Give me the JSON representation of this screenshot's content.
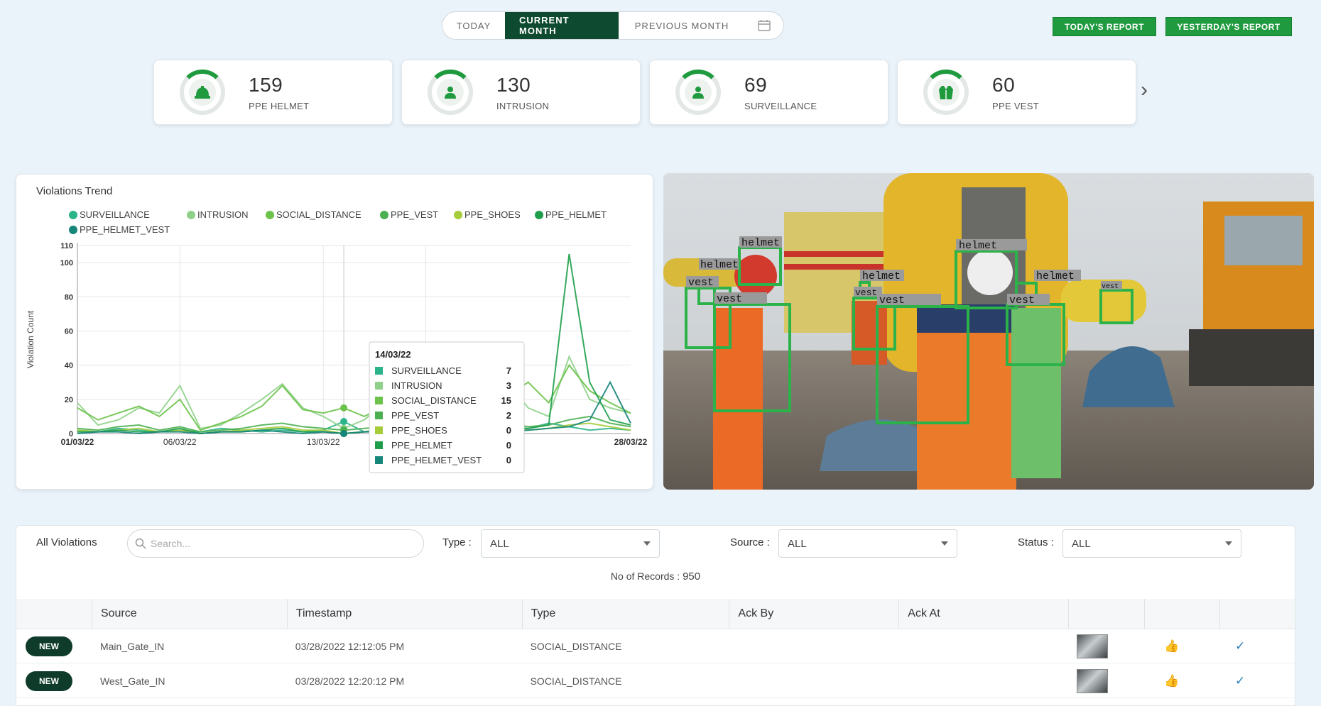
{
  "header": {
    "periods": [
      "TODAY",
      "CURRENT MONTH",
      "PREVIOUS MONTH"
    ],
    "active_period": "CURRENT MONTH",
    "calendar_icon": "calendar-icon",
    "today_report_label": "TODAY'S REPORT",
    "yesterday_report_label": "YESTERDAY'S REPORT"
  },
  "cards": [
    {
      "value": "159",
      "label": "PPE HELMET",
      "icon": "helmet-icon"
    },
    {
      "value": "130",
      "label": "INTRUSION",
      "icon": "person-alert-icon"
    },
    {
      "value": "69",
      "label": "SURVEILLANCE",
      "icon": "person-alert-icon"
    },
    {
      "value": "60",
      "label": "PPE VEST",
      "icon": "vest-icon"
    }
  ],
  "colors": {
    "accent": "#1f9a3f",
    "dark_green": "#0e4a2f",
    "badge": "#0e3b2a",
    "page_bg": "#eaf3fa",
    "detection_box": "#2bb34a"
  },
  "chart_data": {
    "type": "line",
    "title": "Violations Trend",
    "ylabel": "Violation Count",
    "xlabel": "",
    "ylim": [
      0,
      110
    ],
    "y_ticks": [
      0,
      20,
      40,
      60,
      80,
      100,
      110
    ],
    "x_tick_labels": [
      "01/03/22",
      "06/03/22",
      "13/03/22",
      "28/03/22"
    ],
    "legend_position": "top-left",
    "x": [
      "01/03/22",
      "02/03/22",
      "03/03/22",
      "04/03/22",
      "05/03/22",
      "06/03/22",
      "07/03/22",
      "08/03/22",
      "09/03/22",
      "10/03/22",
      "11/03/22",
      "12/03/22",
      "13/03/22",
      "14/03/22",
      "15/03/22",
      "16/03/22",
      "17/03/22",
      "18/03/22",
      "19/03/22",
      "20/03/22",
      "21/03/22",
      "22/03/22",
      "23/03/22",
      "24/03/22",
      "25/03/22",
      "26/03/22",
      "27/03/22",
      "28/03/22"
    ],
    "series": [
      {
        "name": "SURVEILLANCE",
        "color": "#2bb38a",
        "values": [
          2,
          1,
          3,
          2,
          1,
          2,
          1,
          3,
          2,
          1,
          2,
          1,
          2,
          7,
          1,
          3,
          2,
          1,
          2,
          3,
          1,
          2,
          3,
          6,
          4,
          2,
          3,
          2
        ]
      },
      {
        "name": "INTRUSION",
        "color": "#8fd18a",
        "values": [
          18,
          5,
          8,
          15,
          12,
          28,
          3,
          5,
          12,
          20,
          29,
          15,
          10,
          3,
          8,
          18,
          10,
          6,
          12,
          22,
          25,
          30,
          15,
          10,
          45,
          20,
          15,
          12
        ]
      },
      {
        "name": "SOCIAL_DISTANCE",
        "color": "#6cc24a",
        "values": [
          15,
          8,
          12,
          16,
          10,
          20,
          2,
          6,
          10,
          16,
          28,
          14,
          12,
          15,
          10,
          16,
          12,
          8,
          14,
          18,
          20,
          22,
          30,
          18,
          40,
          25,
          18,
          12
        ]
      },
      {
        "name": "PPE_VEST",
        "color": "#4caf50",
        "values": [
          3,
          2,
          4,
          5,
          2,
          4,
          1,
          2,
          3,
          5,
          6,
          4,
          3,
          2,
          3,
          4,
          2,
          3,
          5,
          4,
          3,
          6,
          4,
          5,
          8,
          10,
          6,
          4
        ]
      },
      {
        "name": "PPE_SHOES",
        "color": "#a6cc3a",
        "values": [
          2,
          1,
          2,
          3,
          1,
          2,
          0,
          1,
          2,
          3,
          4,
          2,
          2,
          0,
          1,
          2,
          1,
          2,
          3,
          2,
          1,
          3,
          2,
          3,
          5,
          6,
          4,
          2
        ]
      },
      {
        "name": "PPE_HELMET",
        "color": "#1e9e4a",
        "values": [
          1,
          1,
          2,
          1,
          1,
          3,
          0,
          1,
          1,
          2,
          3,
          1,
          1,
          0,
          1,
          2,
          1,
          1,
          2,
          3,
          2,
          4,
          3,
          5,
          105,
          30,
          8,
          5
        ]
      },
      {
        "name": "PPE_HELMET_VEST",
        "color": "#16857a",
        "values": [
          0,
          1,
          1,
          0,
          1,
          1,
          0,
          1,
          1,
          2,
          1,
          0,
          1,
          0,
          1,
          1,
          0,
          1,
          1,
          2,
          1,
          1,
          2,
          3,
          4,
          8,
          30,
          6
        ]
      }
    ],
    "tooltip": {
      "date": "14/03/22",
      "rows": [
        {
          "name": "SURVEILLANCE",
          "value": "7"
        },
        {
          "name": "INTRUSION",
          "value": "3"
        },
        {
          "name": "SOCIAL_DISTANCE",
          "value": "15"
        },
        {
          "name": "PPE_VEST",
          "value": "2"
        },
        {
          "name": "PPE_SHOES",
          "value": "0"
        },
        {
          "name": "PPE_HELMET",
          "value": "0"
        },
        {
          "name": "PPE_HELMET_VEST",
          "value": "0"
        }
      ]
    }
  },
  "camera": {
    "detections": [
      "helmet",
      "helmet",
      "helmet",
      "helmet",
      "helmet",
      "vest",
      "vest",
      "vest",
      "vest",
      "vest",
      "vest"
    ]
  },
  "violations": {
    "title": "All Violations",
    "search_placeholder": "Search...",
    "type_label": "Type :",
    "type_value": "ALL",
    "source_label": "Source :",
    "source_value": "ALL",
    "status_label": "Status :",
    "status_value": "ALL",
    "records_label": "No of Records :",
    "records_count": "950",
    "columns": [
      "Source",
      "Timestamp",
      "Type",
      "Ack By",
      "Ack At"
    ],
    "rows": [
      {
        "status": "NEW",
        "source": "Main_Gate_IN",
        "timestamp": "03/28/2022 12:12:05 PM",
        "type": "SOCIAL_DISTANCE",
        "ack_by": "",
        "ack_at": ""
      },
      {
        "status": "NEW",
        "source": "West_Gate_IN",
        "timestamp": "03/28/2022 12:20:12 PM",
        "type": "SOCIAL_DISTANCE",
        "ack_by": "",
        "ack_at": ""
      }
    ]
  }
}
